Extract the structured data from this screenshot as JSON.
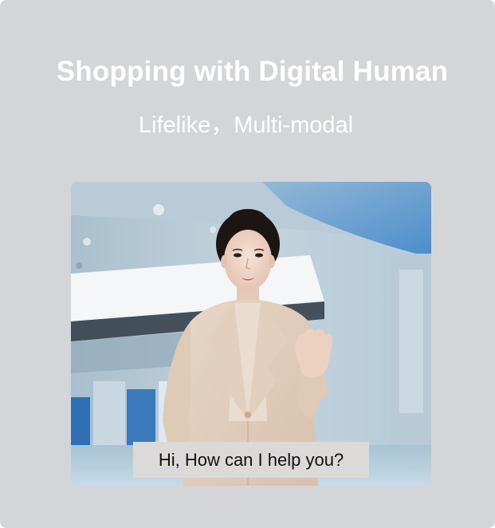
{
  "header": {
    "title": "Shopping with Digital Human",
    "subtitle": "Lifelike，Multi-modal"
  },
  "video": {
    "caption": "Hi, How can I help you?"
  }
}
